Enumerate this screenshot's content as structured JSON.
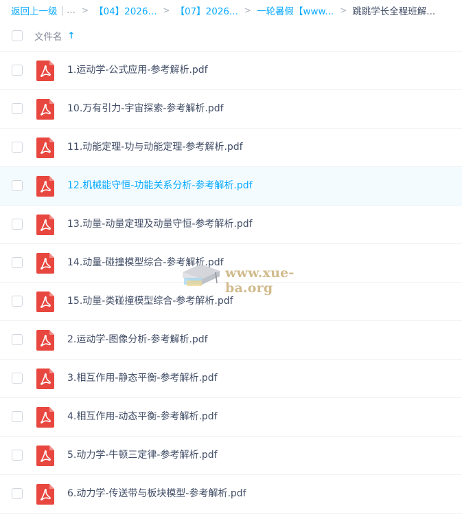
{
  "breadcrumb": {
    "back": "返回上一级",
    "ellipsis": "...",
    "crumbs": [
      "【04】2026...",
      "【07】2026...",
      "一轮暑假【www..."
    ],
    "current": "跳跳学长全程班解..."
  },
  "header": {
    "filename_label": "文件名",
    "sort_icon": "arrow-up-icon"
  },
  "files": [
    {
      "name": "1.运动学-公式应用-参考解析.pdf"
    },
    {
      "name": "10.万有引力-宇宙探索-参考解析.pdf"
    },
    {
      "name": "11.动能定理-功与动能定理-参考解析.pdf"
    },
    {
      "name": "12.机械能守恒-功能关系分析-参考解析.pdf"
    },
    {
      "name": "13.动量-动量定理及动量守恒-参考解析.pdf"
    },
    {
      "name": "14.动量-碰撞模型综合-参考解析.pdf"
    },
    {
      "name": "15.动量-类碰撞模型综合-参考解析.pdf"
    },
    {
      "name": "2.运动学-图像分析-参考解析.pdf"
    },
    {
      "name": "3.相互作用-静态平衡-参考解析.pdf"
    },
    {
      "name": "4.相互作用-动态平衡-参考解析.pdf"
    },
    {
      "name": "5.动力学-牛顿三定律-参考解析.pdf"
    },
    {
      "name": "6.动力学-传送带与板块模型-参考解析.pdf"
    }
  ],
  "watermark": {
    "text": "www.xue-ba.org"
  },
  "colors": {
    "accent": "#09aaff",
    "pdf_red": "#e8473f",
    "hover_bg": "#f4fbff"
  }
}
